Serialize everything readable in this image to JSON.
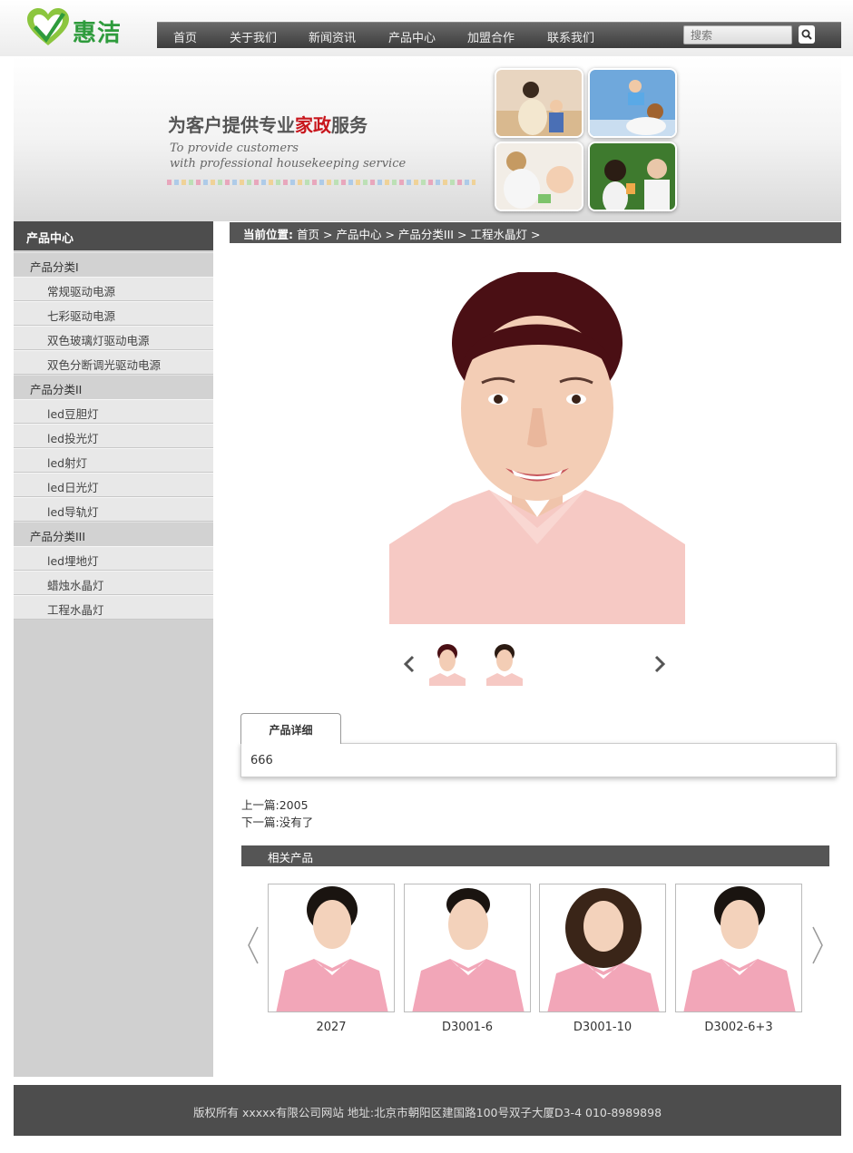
{
  "brand": {
    "name": "惠洁",
    "green": "#2e9b3c",
    "logo_icon": "heart-check-icon"
  },
  "nav": {
    "items": [
      "首页",
      "关于我们",
      "新闻资讯",
      "产品中心",
      "加盟合作",
      "联系我们"
    ],
    "search_placeholder": "搜索",
    "search_icon": "search-icon"
  },
  "banner": {
    "title_pre": "为客户提供专业",
    "title_highlight": "家政",
    "title_post": "服务",
    "sub_line1": "To provide customers",
    "sub_line2": "with professional housekeeping service",
    "highlight_color": "#c8161d"
  },
  "sidebar": {
    "title": "产品中心",
    "groups": [
      {
        "label": "产品分类I",
        "items": [
          "常规驱动电源",
          "七彩驱动电源",
          "双色玻璃灯驱动电源",
          "双色分断调光驱动电源"
        ]
      },
      {
        "label": "产品分类II",
        "items": [
          "led豆胆灯",
          "led投光灯",
          "led射灯",
          "led日光灯",
          "led导轨灯"
        ]
      },
      {
        "label": "产品分类III",
        "items": [
          "led埋地灯",
          "蜡烛水晶灯",
          "工程水晶灯"
        ]
      }
    ]
  },
  "breadcrumb": {
    "prefix": "当前位置:",
    "items": [
      "首页",
      "产品中心",
      "产品分类III",
      "工程水晶灯"
    ],
    "sep": ">"
  },
  "product": {
    "tab_label": "产品详细",
    "detail": "666",
    "prev_label": "上一篇:",
    "prev_value": "2005",
    "next_label": "下一篇:",
    "next_value": "没有了"
  },
  "related": {
    "title": "相关产品",
    "items": [
      "2027",
      "D3001-6",
      "D3001-10",
      "D3002-6+3"
    ]
  },
  "footer": {
    "text": "版权所有 xxxxx有限公司网站 地址:北京市朝阳区建国路100号双子大厦D3-4 010-8989898"
  }
}
